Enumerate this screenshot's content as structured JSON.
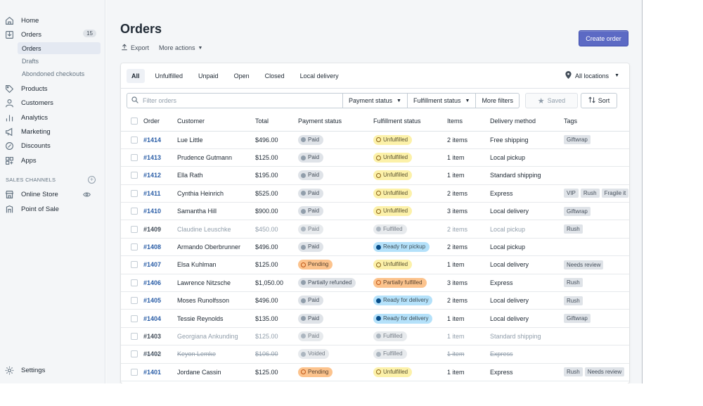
{
  "sidebar": {
    "home": "Home",
    "orders": "Orders",
    "orders_count": "15",
    "sub_orders": "Orders",
    "drafts": "Drafts",
    "abandoned": "Abondoned checkouts",
    "products": "Products",
    "customers": "Customers",
    "analytics": "Analytics",
    "marketing": "Marketing",
    "discounts": "Discounts",
    "apps": "Apps",
    "sales_channels": "SALES CHANNELS",
    "online_store": "Online Store",
    "point_of_sale": "Point of Sale",
    "settings": "Settings"
  },
  "page": {
    "title": "Orders",
    "export": "Export",
    "more_actions": "More actions",
    "create_order": "Create order"
  },
  "tabs": [
    "All",
    "Unfulfilled",
    "Unpaid",
    "Open",
    "Closed",
    "Local delivery"
  ],
  "locations": "All locations",
  "filters": {
    "placeholder": "Filter orders",
    "payment_status": "Payment status",
    "fulfillment_status": "Fulfillment status",
    "more_filters": "More filters",
    "saved": "Saved",
    "sort": "Sort"
  },
  "columns": [
    "Order",
    "Customer",
    "Total",
    "Payment status",
    "Fulfillment status",
    "Items",
    "Delivery method",
    "Tags"
  ],
  "orders": [
    {
      "id": "#1414",
      "customer": "Lue Little",
      "total": "$496.00",
      "payment": "Paid",
      "payment_style": "gray",
      "fulfillment": "Unfulfilled",
      "fulfillment_style": "yellow",
      "items": "2 items",
      "delivery": "Free shipping",
      "tags": [
        "Giftwrap"
      ],
      "muted": false,
      "strike": false
    },
    {
      "id": "#1413",
      "customer": "Prudence Gutmann",
      "total": "$125.00",
      "payment": "Paid",
      "payment_style": "gray",
      "fulfillment": "Unfulfilled",
      "fulfillment_style": "yellow",
      "items": "1 item",
      "delivery": "Local pickup",
      "tags": [],
      "muted": false,
      "strike": false
    },
    {
      "id": "#1412",
      "customer": "Ella Rath",
      "total": "$195.00",
      "payment": "Paid",
      "payment_style": "gray",
      "fulfillment": "Unfulfilled",
      "fulfillment_style": "yellow",
      "items": "1 item",
      "delivery": "Standard shipping",
      "tags": [],
      "muted": false,
      "strike": false
    },
    {
      "id": "#1411",
      "customer": "Cynthia Heinrich",
      "total": "$525.00",
      "payment": "Paid",
      "payment_style": "gray",
      "fulfillment": "Unfulfilled",
      "fulfillment_style": "yellow",
      "items": "2 items",
      "delivery": "Express",
      "tags": [
        "VIP",
        "Rush",
        "Fragile it"
      ],
      "muted": false,
      "strike": false
    },
    {
      "id": "#1410",
      "customer": "Samantha Hill",
      "total": "$900.00",
      "payment": "Paid",
      "payment_style": "gray",
      "fulfillment": "Unfulfilled",
      "fulfillment_style": "yellow",
      "items": "3 items",
      "delivery": "Local delivery",
      "tags": [
        "Giftwrap"
      ],
      "muted": false,
      "strike": false
    },
    {
      "id": "#1409",
      "customer": "Claudine Leuschke",
      "total": "$450.00",
      "payment": "Paid",
      "payment_style": "gray",
      "fulfillment": "Fulfilled",
      "fulfillment_style": "gray",
      "items": "2 items",
      "delivery": "Local pickup",
      "tags": [
        "Rush"
      ],
      "muted": true,
      "strike": false
    },
    {
      "id": "#1408",
      "customer": "Armando Oberbrunner",
      "total": "$496.00",
      "payment": "Paid",
      "payment_style": "gray",
      "fulfillment": "Ready for pickup",
      "fulfillment_style": "blue",
      "items": "2 items",
      "delivery": "Local pickup",
      "tags": [],
      "muted": false,
      "strike": false
    },
    {
      "id": "#1407",
      "customer": "Elsa Kuhlman",
      "total": "$125.00",
      "payment": "Pending",
      "payment_style": "orange",
      "fulfillment": "Unfulfilled",
      "fulfillment_style": "yellow",
      "items": "1 item",
      "delivery": "Local delivery",
      "tags": [
        "Needs review"
      ],
      "muted": false,
      "strike": false
    },
    {
      "id": "#1406",
      "customer": "Lawrence Nitzsche",
      "total": "$1,050.00",
      "payment": "Partially refunded",
      "payment_style": "gray",
      "fulfillment": "Partially fulfilled",
      "fulfillment_style": "orange",
      "items": "3 items",
      "delivery": "Express",
      "tags": [
        "Rush"
      ],
      "muted": false,
      "strike": false
    },
    {
      "id": "#1405",
      "customer": "Moses Runolfsson",
      "total": "$496.00",
      "payment": "Paid",
      "payment_style": "gray",
      "fulfillment": "Ready for delivery",
      "fulfillment_style": "blue",
      "items": "2 items",
      "delivery": "Local delivery",
      "tags": [
        "Rush"
      ],
      "muted": false,
      "strike": false
    },
    {
      "id": "#1404",
      "customer": "Tessie Reynolds",
      "total": "$135.00",
      "payment": "Paid",
      "payment_style": "gray",
      "fulfillment": "Ready for delivery",
      "fulfillment_style": "blue",
      "items": "1 item",
      "delivery": "Local delivery",
      "tags": [
        "Giftwrap"
      ],
      "muted": false,
      "strike": false
    },
    {
      "id": "#1403",
      "customer": "Georgiana Ankunding",
      "total": "$125.00",
      "payment": "Paid",
      "payment_style": "gray",
      "fulfillment": "Fulfilled",
      "fulfillment_style": "gray",
      "items": "1 item",
      "delivery": "Standard shipping",
      "tags": [],
      "muted": true,
      "strike": false
    },
    {
      "id": "#1402",
      "customer": "Keyon Lemke",
      "total": "$106.00",
      "payment": "Voided",
      "payment_style": "gray",
      "fulfillment": "Fulfilled",
      "fulfillment_style": "gray",
      "items": "1 item",
      "delivery": "Express",
      "tags": [],
      "muted": true,
      "strike": true
    },
    {
      "id": "#1401",
      "customer": "Jordane Cassin",
      "total": "$125.00",
      "payment": "Pending",
      "payment_style": "orange",
      "fulfillment": "Unfulfilled",
      "fulfillment_style": "yellow",
      "items": "1 item",
      "delivery": "Express",
      "tags": [
        "Rush",
        "Needs review"
      ],
      "muted": false,
      "strike": false
    }
  ]
}
